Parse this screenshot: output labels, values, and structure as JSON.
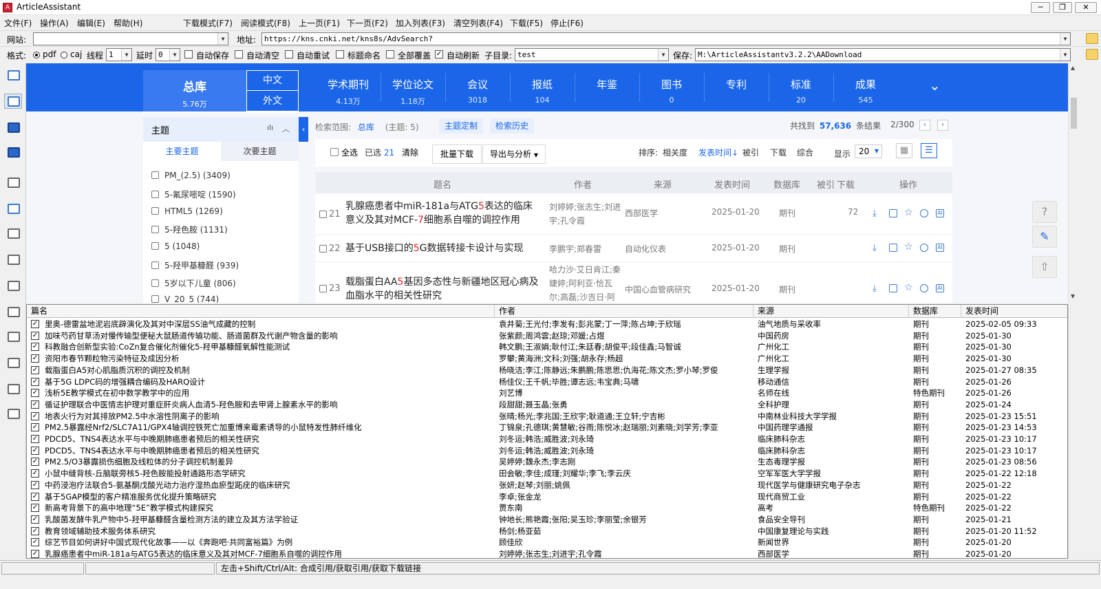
{
  "app": {
    "title": "ArticleAssistant",
    "icon": "app-icon"
  },
  "window_controls": {
    "minimize": "─",
    "restore": "❐",
    "close": "✕"
  },
  "menu": [
    "文件(F)",
    "操作(A)",
    "编辑(E)",
    "帮助(H)",
    "下载模式(F7)",
    "阅读模式(F8)",
    "上一页(F1)",
    "下一页(F2)",
    "加入列表(F3)",
    "清空列表(F4)",
    "下载(F5)",
    "停止(F6)"
  ],
  "address_row": {
    "site_label": "网站:",
    "site_value": "",
    "address_label": "地址:",
    "address_value": "https://kns.cnki.net/kns8s/AdvSearch?"
  },
  "options_row": {
    "format_label": "格式:",
    "pdf_label": "pdf",
    "caj_label": "caj",
    "thread_label": "线程",
    "thread_value": "1",
    "delay_label": "延时",
    "delay_value": "0",
    "auto_save": "自动保存",
    "auto_clear": "自动清空",
    "auto_retry": "自动重试",
    "title_naming": "标题命名",
    "overwrite_all": "全部覆盖",
    "auto_refresh": "自动刷新",
    "subdir_label": "子目录:",
    "subdir_value": "test",
    "save_label": "保存:",
    "save_value": "M:\\ArticleAssistantv3.2.2\\AADownload"
  },
  "cnki": {
    "zongku": {
      "name": "总库",
      "count": "5.76万",
      "zh": "中文",
      "wy": "外文"
    },
    "db_tabs": [
      {
        "name": "学术期刊",
        "count": "4.13万"
      },
      {
        "name": "学位论文",
        "count": "1.18万"
      },
      {
        "name": "会议",
        "count": "3018"
      },
      {
        "name": "报纸",
        "count": "104"
      },
      {
        "name": "年鉴",
        "count": ""
      },
      {
        "name": "图书",
        "count": "0"
      },
      {
        "name": "专利",
        "count": ""
      },
      {
        "name": "标准",
        "count": "20"
      },
      {
        "name": "成果",
        "count": "545"
      }
    ],
    "facet": {
      "title": "主题",
      "tab_main": "主要主题",
      "tab_secondary": "次要主题",
      "items": [
        "PM_(2.5) (3409)",
        "5-氟尿嘧啶 (1590)",
        "HTML5 (1269)",
        "5-羟色胺 (1131)",
        "5 (1048)",
        "5-羟甲基糠醛 (939)",
        "5岁以下儿童 (806)",
        "V_20_5 (744)"
      ]
    },
    "search_info": {
      "range_label": "检索范围:",
      "range_value": "总库",
      "topic": "(主题: 5)",
      "custom": "主题定制",
      "history": "检索历史",
      "found_label": "共找到",
      "found_count": "57,636",
      "found_unit": "条结果",
      "page": "2/300"
    },
    "toolbar": {
      "select_all": "全选",
      "selected_label": "已选",
      "selected_count": "21",
      "clear": "清除",
      "batch_download": "批量下载",
      "export": "导出与分析",
      "sort_label": "排序:",
      "sort_relevance": "相关度",
      "sort_time": "发表时间",
      "sort_cited": "被引",
      "sort_download": "下载",
      "sort_overall": "综合",
      "display_label": "显示",
      "display_value": "20"
    },
    "columns": [
      "题名",
      "作者",
      "来源",
      "发表时间",
      "数据库",
      "被引",
      "下载",
      "操作"
    ],
    "rows": [
      {
        "no": "21",
        "title_a": "乳腺癌患者中miR-181a与ATG",
        "title_r1": "5",
        "title_b": "表达的临床意义及其对MCF-",
        "title_r2": "7",
        "title_c": "细胞系自噬的调控作用",
        "authors": "刘婷婷;张志生;刘进宇;孔令霞",
        "source": "西部医学",
        "date": "2025-01-20",
        "db": "期刊",
        "cited": "",
        "downloads": "72"
      },
      {
        "no": "22",
        "title_a": "基于USB接口的",
        "title_r1": "5",
        "title_b": "G数据转接卡设计与实现",
        "title_r2": "",
        "title_c": "",
        "authors": "李鹏宇;郑春雷",
        "source": "自动化仪表",
        "date": "2025-01-20",
        "db": "期刊",
        "cited": "",
        "downloads": ""
      },
      {
        "no": "23",
        "title_a": "载脂蛋白AA",
        "title_r1": "5",
        "title_b": "基因多态性与新疆地区冠心病及血脂水平的相关性研究",
        "title_r2": "",
        "title_c": "",
        "authors": "哈力沙·艾日肯江;秦婕婷;阿利亚·恰瓦尔;高磊;沙吉日·阿",
        "source": "中国心血管病研究",
        "date": "2025-01-20",
        "db": "期刊",
        "cited": "",
        "downloads": ""
      }
    ]
  },
  "grid": {
    "headers": [
      "篇名",
      "作者",
      "来源",
      "数据库",
      "发表时间"
    ],
    "rows": [
      [
        "里奥-德雷盆地泥岩底辟演化及其对中深层SS油气成藏的控制",
        "袁井菊;王光付;李发有;彭兆蒙;丁一萍;陈占坤;于欣瑶",
        "油气地质与采收率",
        "期刊",
        "2025-02-05 09:33"
      ],
      [
        "加味芍药甘草汤对慢传输型便秘大鼠肠道传输功能、肠道菌群及代谢产物含量的影响",
        "张紫颜;周鸿雲;赵琼;邓媛;占煜",
        "中国药房",
        "期刊",
        "2025-01-30"
      ],
      [
        "科教融合创新型实验:CoZn复合催化剂催化5-羟甲基糠醛氧解性能测试",
        "韩文鹏;王淑娟;耿付江;朱廷春;胡俊平;段佳鑫;马智诚",
        "广州化工",
        "期刊",
        "2025-01-30"
      ],
      [
        "资阳市春节颗粒物污染特征及成因分析",
        "罗攀;黄海洲;文科;刘强;胡永存;杨超",
        "广州化工",
        "期刊",
        "2025-01-30"
      ],
      [
        "载脂蛋白A5对心肌脂质沉积的调控及机制",
        "杨晓洁;李江;陈静远;朱鹏鹏;陈思思;仇海花;陈文杰;罗小琴;罗俊",
        "生理学报",
        "期刊",
        "2025-01-27 08:35"
      ],
      [
        "基于5G LDPC码的增强耦合编码及HARQ设计",
        "杨佳仪;王千帆;毕胜;谭志远;韦宝典;马啸",
        "移动通信",
        "期刊",
        "2025-01-26"
      ],
      [
        "浅析5E教学模式在初中数学教学中的应用",
        "刘艺博",
        "名师在线",
        "特色期刊",
        "2025-01-26"
      ],
      [
        "循证护理联合中医情志护理对重症肝炎病人血清5-羟色胺和去甲肾上腺素水平的影响",
        "段甜甜;聂玉晶;张勇",
        "全科护理",
        "期刊",
        "2025-01-24"
      ],
      [
        "地表火行为对其排放PM2.5中水溶性阴离子的影响",
        "张晴;杨光;李兆国;王欣宇;耿道通;王立轩;宁吉彬",
        "中南林业科技大学学报",
        "期刊",
        "2025-01-23 15:51"
      ],
      [
        "PM2.5暴露经Nrf2/SLC7A11/GPX4轴调控铁死亡加重博来霉素诱导的小鼠特发性肺纤维化",
        "丁锦泉;孔德琪;黄慧敏;谷雨;陈悦冰;赵瑞丽;刘素晓;刘学芳;李亚",
        "中国药理学通报",
        "期刊",
        "2025-01-23 14:53"
      ],
      [
        "PDCD5、TNS4表达水平与中晚期肺癌患者预后的相关性研究",
        "刘冬运;韩浩;威胜波;刘永琦",
        "临床肺科杂志",
        "期刊",
        "2025-01-23 10:17"
      ],
      [
        "PDCD5、TNS4表达水平与中晚期肺癌患者预后的相关性研究",
        "刘冬运;韩浩;威胜波;刘永琦",
        "临床肺科杂志",
        "期刊",
        "2025-01-23 10:17"
      ],
      [
        "PM2.5/O3暴露损伤细胞及线粒体的分子调控机制差异",
        "吴婷婷;魏永杰;李志刚",
        "生态毒理学报",
        "期刊",
        "2025-01-23 08:56"
      ],
      [
        "小鼠中缝背核-丘脑联旁核5-羟色胺能投射通路形态学研究",
        "田会敏;李佳;成瑾;刘耀华;李飞;李云庆",
        "空军军医大学学报",
        "期刊",
        "2025-01-22 12:18"
      ],
      [
        "中药浸泡疗法联合5-氨基酮戊酸光动力治疗湿热血瘀型跖疣的临床研究",
        "张妍;赵琴;刘丽;姚佩",
        "现代医学与健康研究电子杂志",
        "期刊",
        "2025-01-22"
      ],
      [
        "基于5GAP模型的客户精准服务优化提升策略研究",
        "李卓;张金龙",
        "现代商贸工业",
        "期刊",
        "2025-01-22"
      ],
      [
        "新高考背景下的高中地理“5E”教学模式构建探究",
        "贾东南",
        "高考",
        "特色期刊",
        "2025-01-22"
      ],
      [
        "乳酸菌发酵牛乳产物中5-羟甲基糠醛含量检测方法的建立及其方法学验证",
        "钟地长;熊艳霞;张阳;吴玉珍;李丽莹;余银芳",
        "食品安全导刊",
        "期刊",
        "2025-01-21"
      ],
      [
        "教育领域辅助技术服务体系研究",
        "杨剑;杨亚茹",
        "中国康复理论与实践",
        "期刊",
        "2025-01-20 11:52"
      ],
      [
        "综艺节目如何讲好中国式现代化故事——以《奔跑吧·共同富裕篇》为例",
        "顾佳欣",
        "新闻世界",
        "期刊",
        "2025-01-20"
      ],
      [
        "乳腺癌患者中miR-181a与ATG5表达的临床意义及其对MCF-7细胞系自噬的调控作用",
        "刘婷婷;张志生;刘进宇;孔令霞",
        "西部医学",
        "期刊",
        "2025-01-20"
      ]
    ]
  },
  "status": {
    "hint": "左击+Shift/Ctrl/Alt: 合成引用/获取引用/获取下载链接"
  },
  "colors": {
    "brand_blue": "#1b66e8",
    "highlight_red": "#e22",
    "link_blue": "#1b66e8"
  }
}
